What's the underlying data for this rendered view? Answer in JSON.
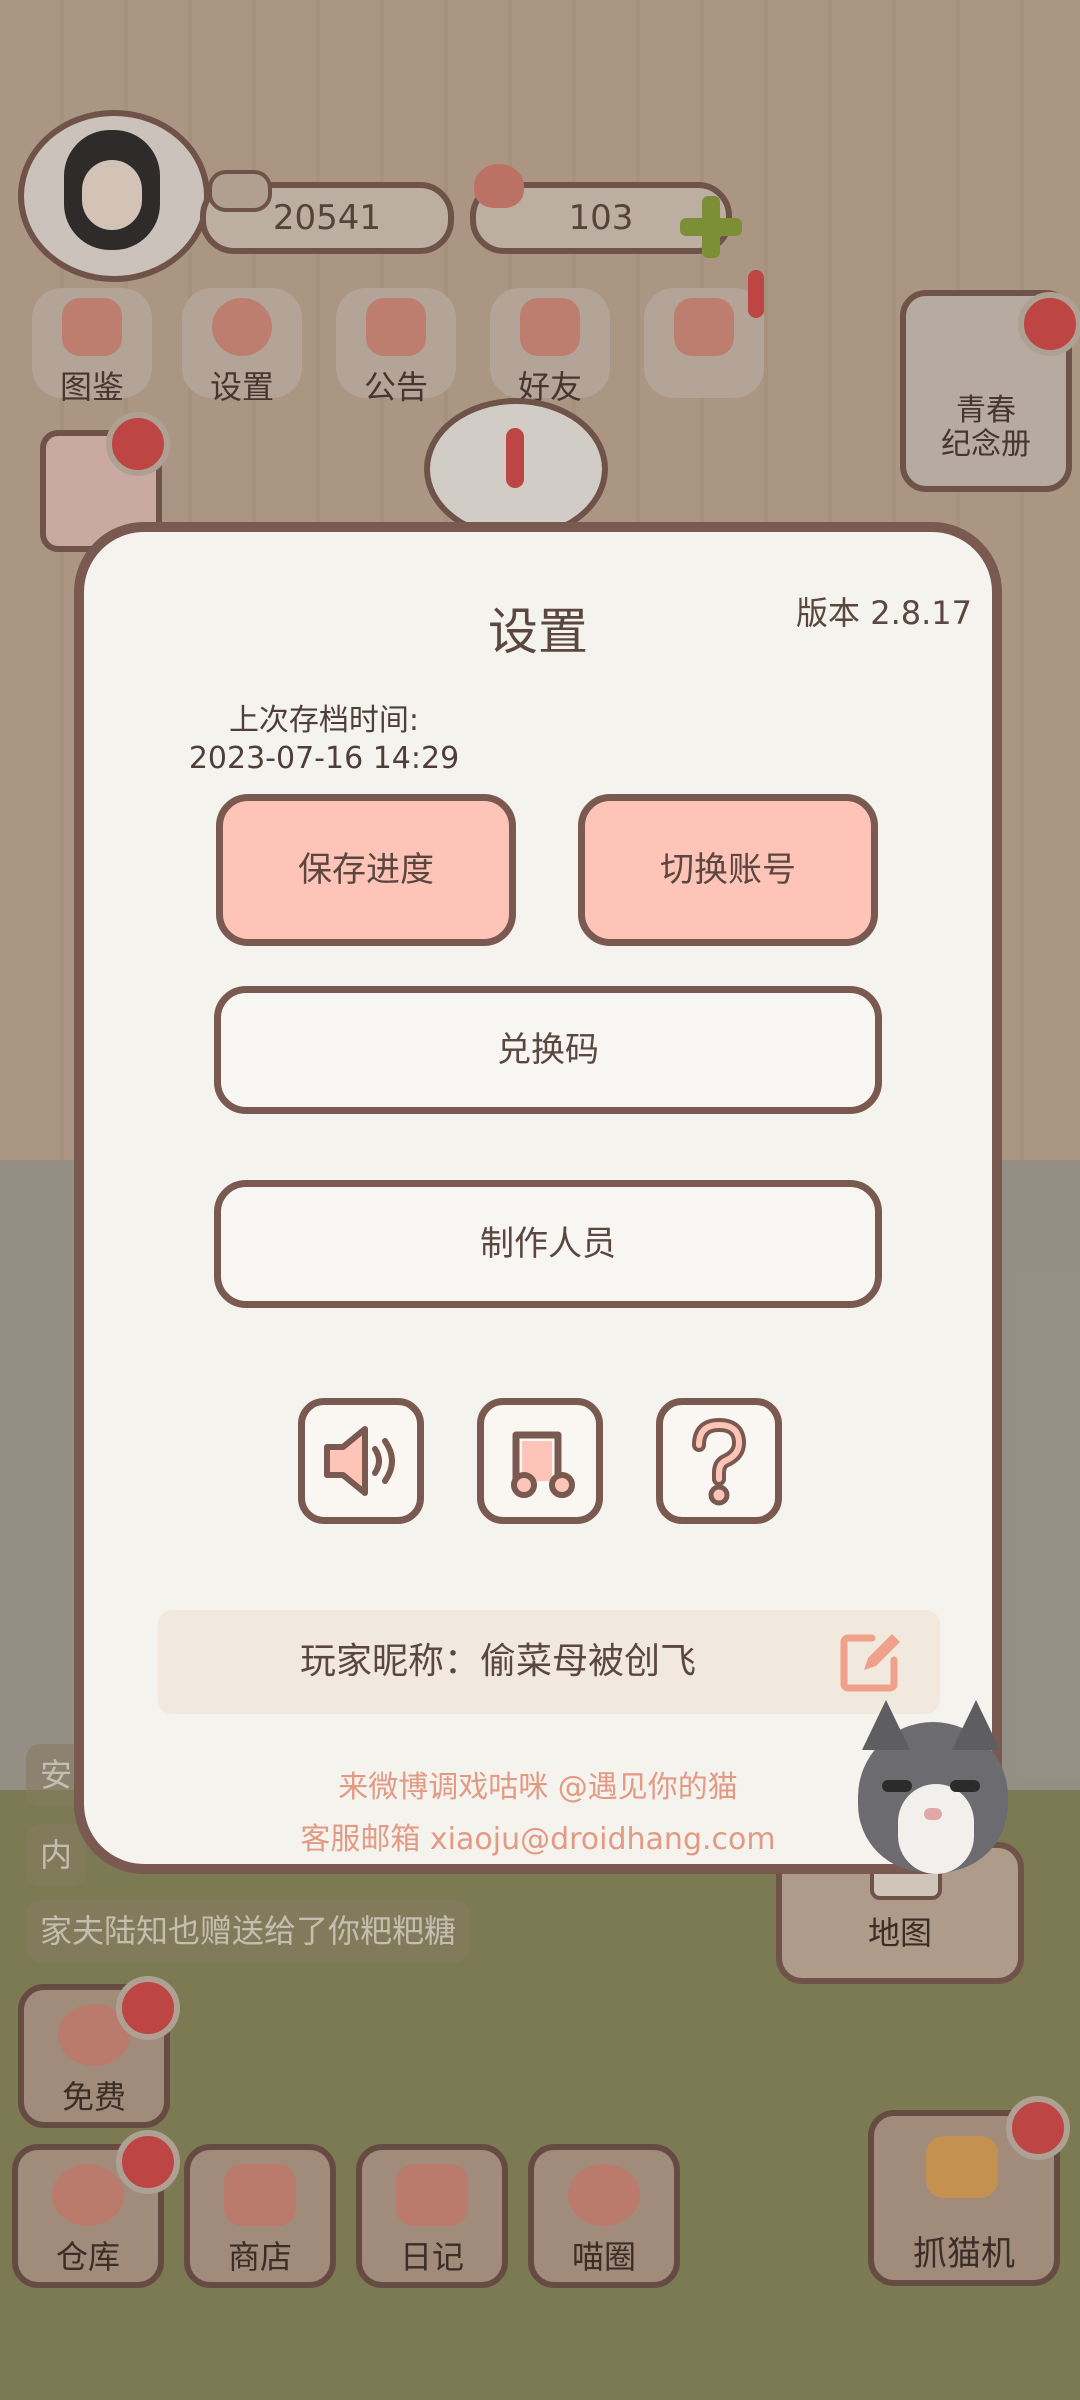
{
  "hud": {
    "coins": "20541",
    "hearts": "103"
  },
  "top_menu": [
    {
      "label": "图鉴"
    },
    {
      "label": "设置"
    },
    {
      "label": "公告"
    },
    {
      "label": "好友"
    }
  ],
  "side": {
    "album_label": "青春\n纪念册",
    "map_label": "地图"
  },
  "chat": {
    "line1": "安",
    "line2": "内",
    "line3": "家夫陆知也赠送给了你粑粑糖"
  },
  "bottom": {
    "free_label": "免费",
    "warehouse_label": "仓库",
    "shop_label": "商店",
    "diary_label": "日记",
    "circle_label": "喵圈",
    "claw_label": "抓猫机"
  },
  "settings": {
    "title": "设置",
    "version": "版本 2.8.17",
    "last_save_label": "上次存档时间:",
    "last_save_time": "2023-07-16 14:29",
    "save_button": "保存进度",
    "switch_account_button": "切换账号",
    "redeem_button": "兑换码",
    "credits_button": "制作人员",
    "nickname": "玩家昵称：偷菜母被创飞",
    "weibo_text": "来微博调戏咕咪 @遇见你的猫",
    "email_text": "客服邮箱 xiaoju@droidhang.com"
  },
  "colors": {
    "accent_pink": "#ffc4b8",
    "border_brown": "#7a5a50",
    "panel_bg": "#f5f3ee",
    "link_orange": "#e39a84"
  },
  "icons": [
    "sound-icon",
    "music-icon",
    "help-icon",
    "edit-icon"
  ]
}
